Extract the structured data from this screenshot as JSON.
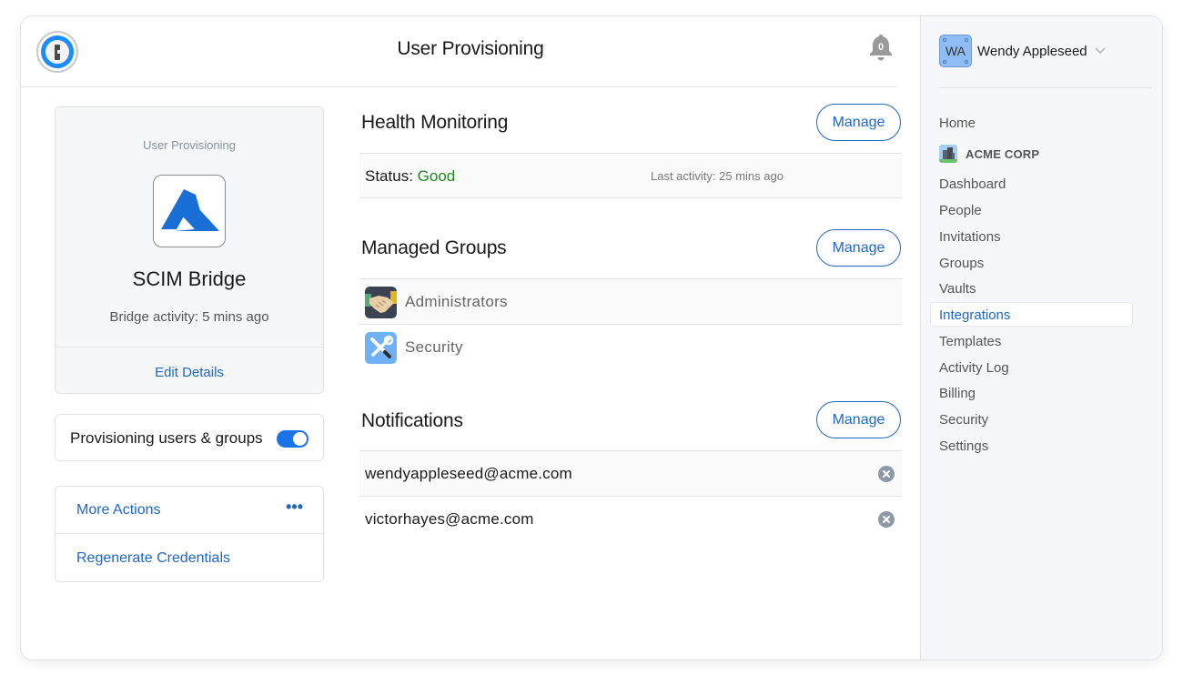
{
  "header": {
    "title": "User Provisioning",
    "notification_count": "0"
  },
  "bridge": {
    "kicker": "User Provisioning",
    "name": "SCIM Bridge",
    "activity": "Bridge activity: 5 mins ago",
    "edit_label": "Edit Details",
    "icon": "azure-logo"
  },
  "provisioning_toggle": {
    "label": "Provisioning users & groups",
    "enabled": true
  },
  "actions": {
    "more_label": "More Actions",
    "more_icon": "ellipsis-icon",
    "regenerate_label": "Regenerate Credentials"
  },
  "health": {
    "title": "Health Monitoring",
    "manage_label": "Manage",
    "status_prefix": "Status: ",
    "status_value": "Good",
    "last_activity": "Last activity: 25 mins ago"
  },
  "groups": {
    "title": "Managed Groups",
    "manage_label": "Manage",
    "items": [
      {
        "name": "Administrators",
        "icon": "handshake-icon"
      },
      {
        "name": "Security",
        "icon": "tools-icon"
      }
    ]
  },
  "notifications": {
    "title": "Notifications",
    "manage_label": "Manage",
    "emails": [
      "wendyappleseed@acme.com",
      "victorhayes@acme.com"
    ]
  },
  "sidebar": {
    "user": {
      "initials": "WA",
      "name": "Wendy Appleseed"
    },
    "home_label": "Home",
    "org_name": "ACME CORP",
    "items": [
      {
        "label": "Dashboard"
      },
      {
        "label": "People"
      },
      {
        "label": "Invitations"
      },
      {
        "label": "Groups"
      },
      {
        "label": "Vaults"
      },
      {
        "label": "Integrations",
        "active": true
      },
      {
        "label": "Templates"
      },
      {
        "label": "Activity Log"
      },
      {
        "label": "Billing"
      },
      {
        "label": "Security"
      },
      {
        "label": "Settings"
      }
    ]
  },
  "colors": {
    "accent": "#1f66c7",
    "status_good": "#1e8a1e",
    "toggle_on": "#1a73e8",
    "sidebar_bg": "#f6f7fa"
  }
}
